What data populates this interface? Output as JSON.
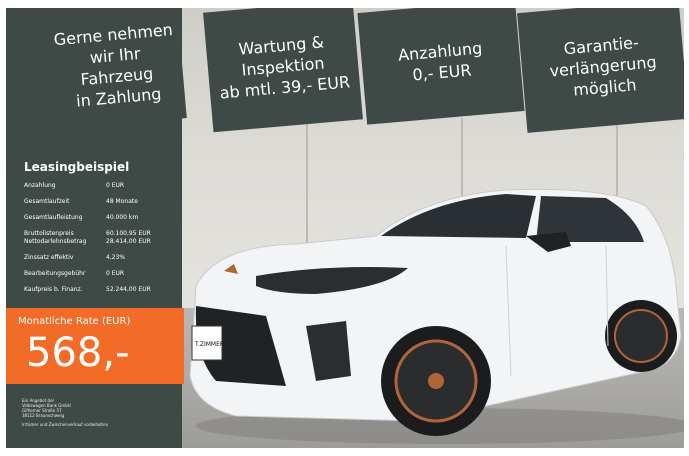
{
  "banners": [
    {
      "text": "Gerne nehmen\nwir Ihr\nFahrzeug\nin Zahlung"
    },
    {
      "text": "Wartung &\nInspektion\nab mtl. 39,- EUR"
    },
    {
      "text": "Anzahlung\n0,- EUR"
    },
    {
      "text": "Garantie-\nverlängerung\nmöglich"
    }
  ],
  "panel": {
    "title": "Leasingbeispiel",
    "rows": [
      {
        "label": "Anzahlung",
        "value": "0 EUR"
      },
      {
        "label": "Gesamtlaufzeit",
        "value": "48 Monate"
      },
      {
        "label": "Gesamtlaufleistung",
        "value": "40.000 km"
      },
      {
        "label": "Bruttolistenpreis",
        "value": "60.100,95 EUR"
      },
      {
        "label": "Nettodarlehnsbetrag",
        "value": "28.414,00 EUR"
      },
      {
        "label": "Zinssatz effektiv",
        "value": "4,23%"
      },
      {
        "label": "Bearbeitungsgebühr",
        "value": "0 EUR"
      },
      {
        "label": "Kaufpreis b. Finanz.",
        "value": "52.244,00 EUR"
      }
    ],
    "rate_label": "Monatliche Rate (EUR)",
    "rate_value": "568,-",
    "footer_lines": [
      "Ein Angebot der",
      "Volkswagen Bank GmbH",
      "Gifhorner Straße 57",
      "38112 Braunschweig"
    ],
    "footer_note": "Irrtümer und Zwischenverkauf vorbehalten"
  },
  "car": {
    "plate_text": "T.ZIMMER"
  },
  "colors": {
    "panel": "#3f4a47",
    "accent": "#f26c28",
    "car_body": "#f3f4f5",
    "rim_accent": "#b0643a"
  }
}
